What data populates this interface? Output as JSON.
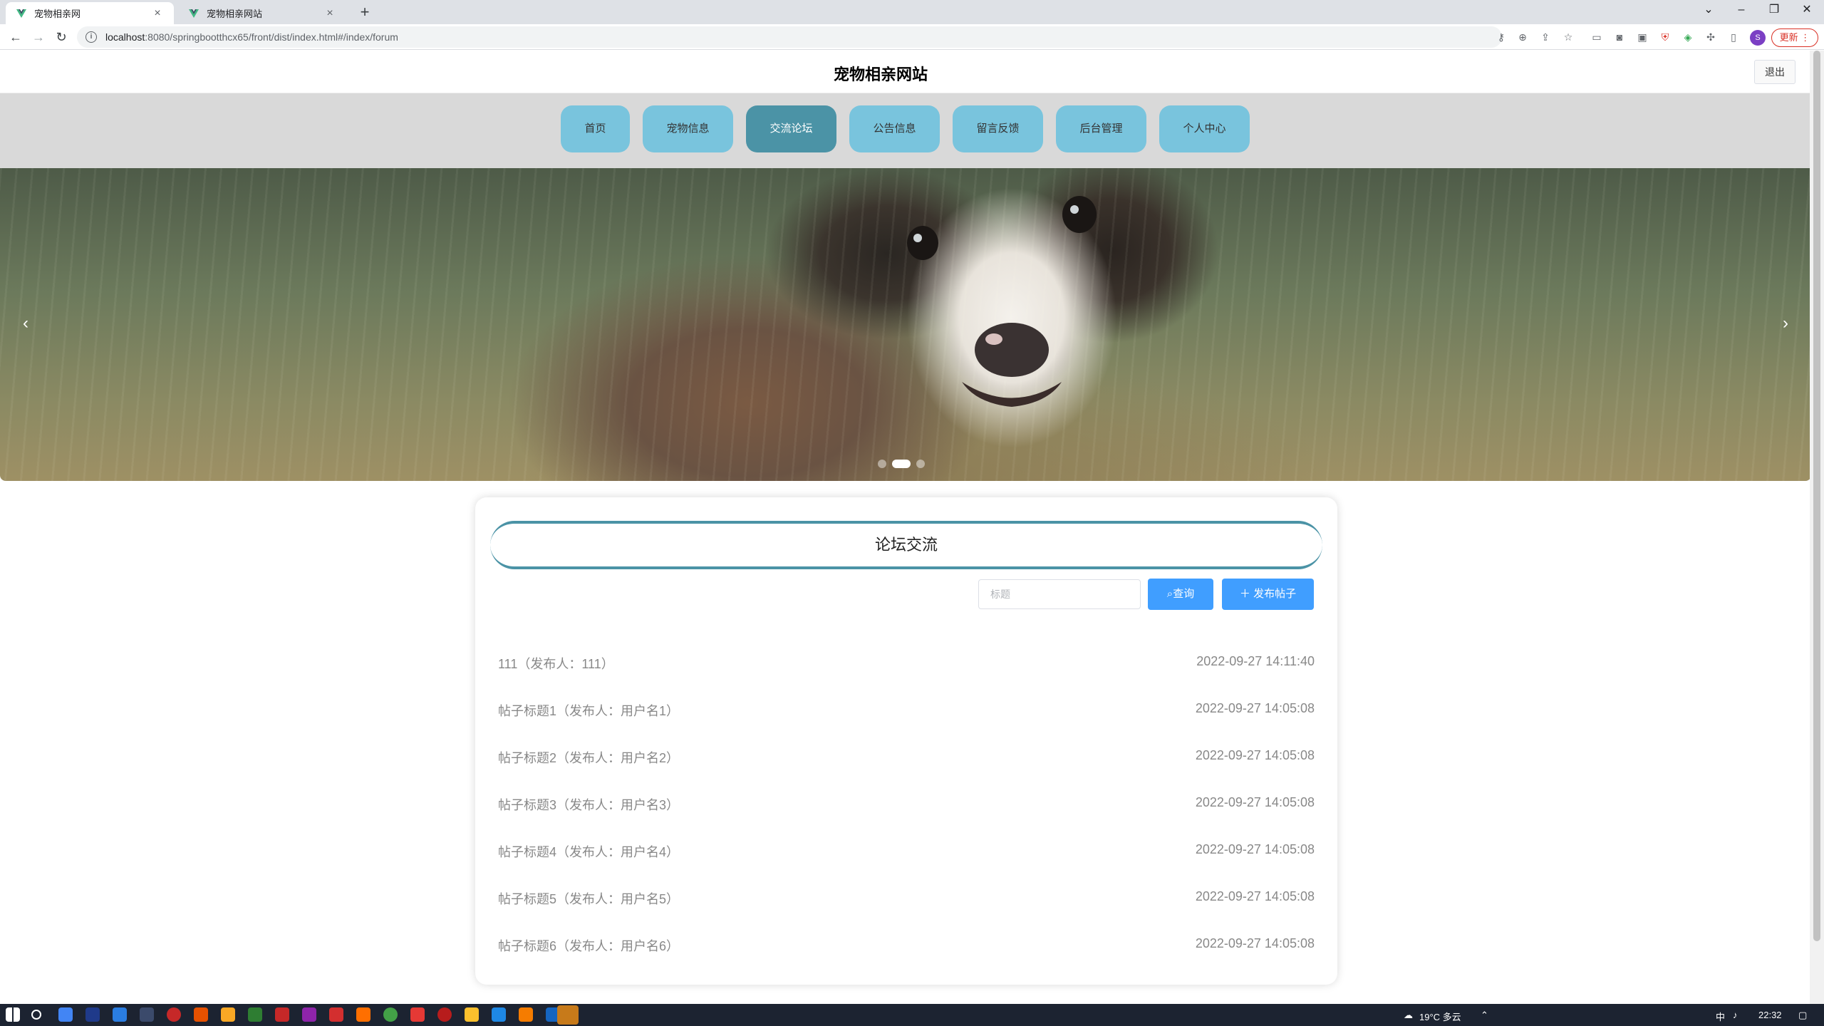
{
  "browser": {
    "tabs": [
      {
        "title": "宠物相亲网",
        "active": true
      },
      {
        "title": "宠物相亲网站",
        "active": false
      }
    ],
    "url_host": "localhost",
    "url_path": ":8080/springbootthcx65/front/dist/index.html#/index/forum",
    "update_label": "更新",
    "profile_initial": "S"
  },
  "header": {
    "site_title": "宠物相亲网站",
    "logout_label": "退出"
  },
  "nav": {
    "items": [
      "首页",
      "宠物信息",
      "交流论坛",
      "公告信息",
      "留言反馈",
      "后台管理",
      "个人中心"
    ],
    "active_index": 2
  },
  "banner": {
    "prev_arrow": "‹",
    "next_arrow": "›",
    "dot_count": 3,
    "active_dot": 1
  },
  "forum": {
    "title": "论坛交流",
    "search_placeholder": "标题",
    "search_value": "",
    "query_label": "查询",
    "publish_label": "发布帖子",
    "posts": [
      {
        "title": "111（发布人：111）",
        "time": "2022-09-27 14:11:40"
      },
      {
        "title": "帖子标题1（发布人：用户名1）",
        "time": "2022-09-27 14:05:08"
      },
      {
        "title": "帖子标题2（发布人：用户名2）",
        "time": "2022-09-27 14:05:08"
      },
      {
        "title": "帖子标题3（发布人：用户名3）",
        "time": "2022-09-27 14:05:08"
      },
      {
        "title": "帖子标题4（发布人：用户名4）",
        "time": "2022-09-27 14:05:08"
      },
      {
        "title": "帖子标题5（发布人：用户名5）",
        "time": "2022-09-27 14:05:08"
      },
      {
        "title": "帖子标题6（发布人：用户名6）",
        "time": "2022-09-27 14:05:08"
      }
    ]
  },
  "taskbar": {
    "weather": "19°C 多云",
    "ime": "中",
    "clock": "22:32"
  },
  "colors": {
    "nav_item": "#79c4dd",
    "nav_active": "#4b93a6",
    "primary_button": "#409eff",
    "title_border": "#4b93a6"
  }
}
